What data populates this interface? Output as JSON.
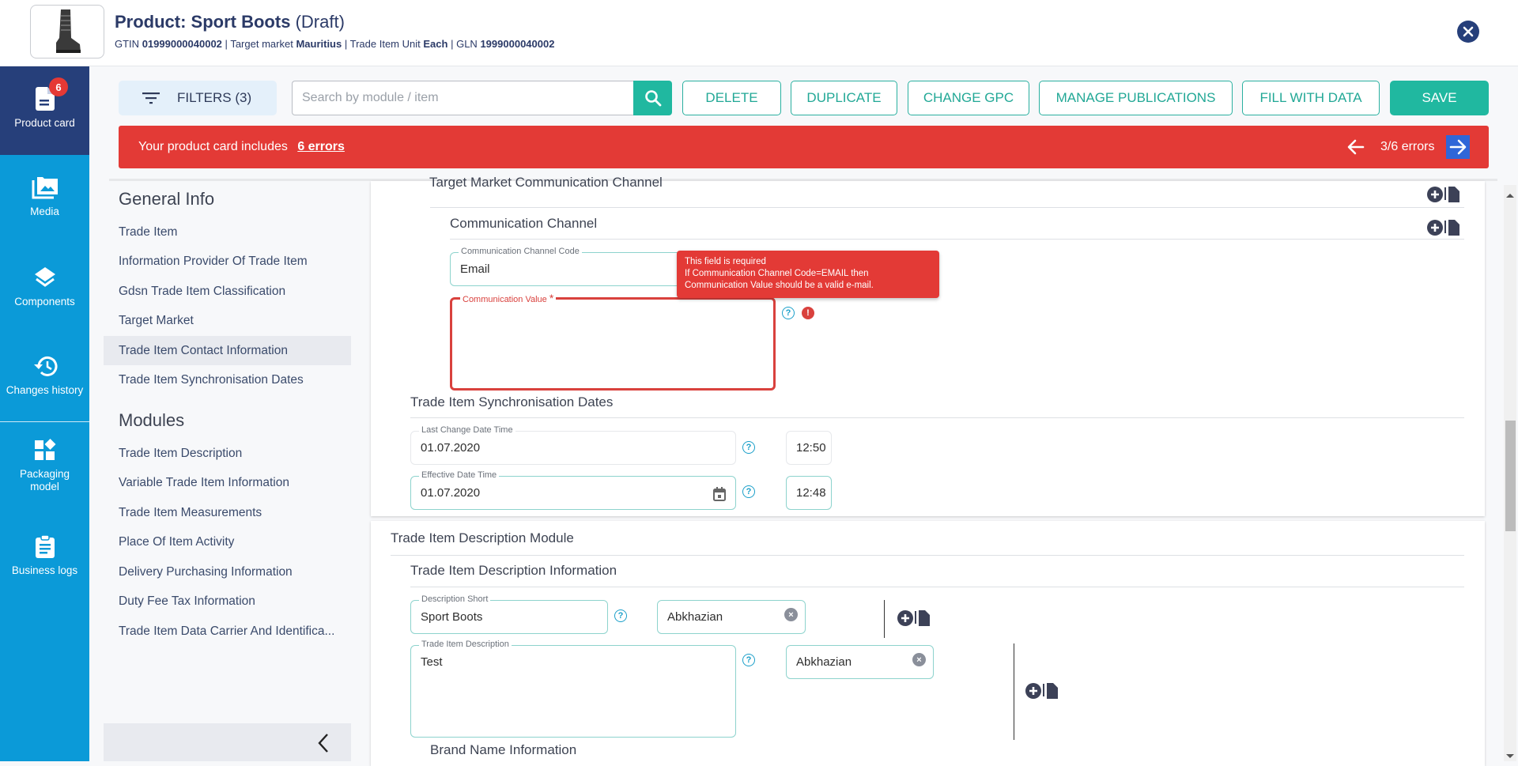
{
  "header": {
    "title_prefix": "Product: Sport Boots",
    "title_status": "(Draft)",
    "meta": {
      "gtin_label": "GTIN",
      "gtin_value": "01999000040002",
      "target_market_label": "Target market",
      "target_market_value": "Mauritius",
      "unit_label": "Trade Item Unit",
      "unit_value": "Each",
      "gln_label": "GLN",
      "gln_value": "1999000040002",
      "separator": "|"
    },
    "close_icon": "close-circle-icon"
  },
  "leftnav": {
    "items": [
      {
        "label": "Product card",
        "icon": "document-icon",
        "badge": "6",
        "active": true
      },
      {
        "label": "Media",
        "icon": "images-icon"
      },
      {
        "label": "Components",
        "icon": "layers-icon"
      },
      {
        "label": "Changes history",
        "icon": "history-icon"
      },
      {
        "label": "Packaging model",
        "icon": "widgets-icon"
      },
      {
        "label": "Business logs",
        "icon": "clipboard-icon"
      }
    ]
  },
  "toolbar": {
    "filters_label": "FILTERS (3)",
    "search_placeholder": "Search by module / item",
    "search_value": "",
    "buttons": [
      "DELETE",
      "DUPLICATE",
      "CHANGE GPC",
      "MANAGE PUBLICATIONS",
      "FILL WITH DATA"
    ],
    "save_label": "SAVE"
  },
  "error_banner": {
    "message": "Your product card includes",
    "link": "6 errors",
    "counter": "3/6 errors",
    "color": "#e33a36"
  },
  "sidebar": {
    "general_heading": "General Info",
    "general_items": [
      "Trade Item",
      "Information Provider Of Trade Item",
      "Gdsn Trade Item Classification",
      "Target Market",
      "Trade Item Contact Information",
      "Trade Item Synchronisation Dates"
    ],
    "active_item": "Trade Item Contact Information",
    "modules_heading": "Modules",
    "module_items": [
      "Trade Item Description",
      "Variable Trade Item Information",
      "Trade Item Measurements",
      "Place Of Item Activity",
      "Delivery Purchasing Information",
      "Duty Fee Tax Information",
      "Trade Item Data Carrier And Identifica..."
    ]
  },
  "contact": {
    "tm_channel_title": "Target Market Communication Channel",
    "channel_title": "Communication Channel",
    "code_label": "Communication Channel Code",
    "code_value": "Email",
    "value_label": "Communication Value",
    "value_required": "*",
    "value_value": "",
    "tooltip_line1": "This field is required",
    "tooltip_line2": "If Communication Channel Code=EMAIL then",
    "tooltip_line3": "Communication Value should be a valid e-mail."
  },
  "sync": {
    "title": "Trade Item Synchronisation Dates",
    "last_change_label": "Last Change Date Time",
    "last_change_date": "01.07.2020",
    "last_change_time": "12:50",
    "effective_label": "Effective Date Time",
    "effective_date": "01.07.2020",
    "effective_time": "12:48"
  },
  "description_module": {
    "title": "Trade Item Description Module",
    "info_title": "Trade Item Description Information",
    "short_label": "Description Short",
    "short_value": "Sport Boots",
    "short_lang": "Abkhazian",
    "desc_label": "Trade Item Description",
    "desc_value": "Test",
    "desc_lang": "Abkhazian",
    "brand_title": "Brand Name Information"
  },
  "icons": {
    "help": "?",
    "error": "!",
    "clear": "×"
  }
}
